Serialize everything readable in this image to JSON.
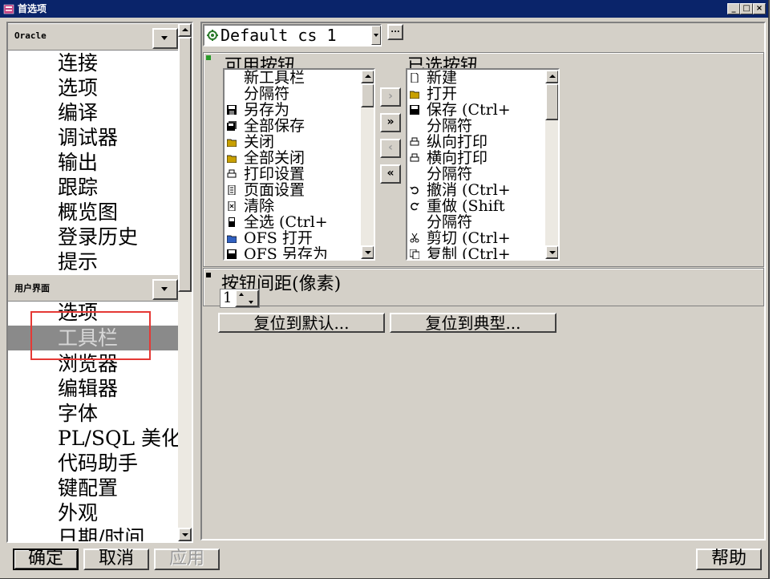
{
  "window": {
    "title": "首选项",
    "controls": [
      "_",
      "□",
      "×"
    ]
  },
  "left_nav": {
    "sections": [
      {
        "header": "Oracle",
        "items": [
          "连接",
          "选项",
          "编译",
          "调试器",
          "输出",
          "跟踪",
          "概览图",
          "登录历史",
          "提示"
        ]
      },
      {
        "header": "用户界面",
        "items": [
          "选项",
          "工具栏",
          "浏览器",
          "编辑器",
          "字体",
          "PL/SQL 美化",
          "代码助手",
          "键配置",
          "外观",
          "日期/时间"
        ],
        "selected_index": 1
      }
    ]
  },
  "toolbar_settings": {
    "settings_file": "Default cs 1",
    "ellipsis_label": "...",
    "available": {
      "title": "可用按钮",
      "items": [
        {
          "label": "新工具栏",
          "icon": "none-icon"
        },
        {
          "label": "分隔符",
          "icon": "none-icon"
        },
        {
          "label": "另存为",
          "icon": "save-icon"
        },
        {
          "label": "全部保存",
          "icon": "save-all-icon"
        },
        {
          "label": "关闭",
          "icon": "folder-icon"
        },
        {
          "label": "全部关闭",
          "icon": "folder-icon"
        },
        {
          "label": "打印设置",
          "icon": "print-setup-icon"
        },
        {
          "label": "页面设置",
          "icon": "page-setup-icon"
        },
        {
          "label": "清除",
          "icon": "clear-icon"
        },
        {
          "label": "全选 (Ctrl+",
          "icon": "select-all-icon"
        },
        {
          "label": "OFS 打开",
          "icon": "open-icon"
        },
        {
          "label": "OFS 另存为",
          "icon": "save-icon"
        }
      ]
    },
    "selected": {
      "title": "已选按钮",
      "items": [
        {
          "label": "新建",
          "icon": "new-icon"
        },
        {
          "label": "打开",
          "icon": "open-icon"
        },
        {
          "label": "保存 (Ctrl+",
          "icon": "save-icon"
        },
        {
          "label": "分隔符",
          "icon": "none-icon"
        },
        {
          "label": "纵向打印",
          "icon": "print-icon"
        },
        {
          "label": "横向打印",
          "icon": "print-icon"
        },
        {
          "label": "分隔符",
          "icon": "none-icon"
        },
        {
          "label": "撤消 (Ctrl+",
          "icon": "undo-icon"
        },
        {
          "label": "重做 (Shift",
          "icon": "redo-icon"
        },
        {
          "label": "分隔符",
          "icon": "none-icon"
        },
        {
          "label": "剪切 (Ctrl+",
          "icon": "cut-icon"
        },
        {
          "label": "复制 (Ctrl+",
          "icon": "copy-icon"
        }
      ]
    },
    "move_buttons": [
      {
        "label": "›",
        "enabled": false
      },
      {
        "label": "»",
        "enabled": true
      },
      {
        "label": "‹",
        "enabled": false
      },
      {
        "label": "«",
        "enabled": true
      }
    ],
    "spacing": {
      "title": "按钮间距(像素)",
      "value": "1"
    },
    "reset_default_label": "复位到默认...",
    "reset_typical_label": "复位到典型..."
  },
  "footer": {
    "ok_label": "确定",
    "cancel_label": "取消",
    "apply_label": "应用",
    "help_label": "帮助"
  },
  "colors": {
    "title_bar": "#0a246a",
    "dialog_bg": "#d4d0c8",
    "selection_bg": "#8a8a8a",
    "annotation_box": "#e53935"
  }
}
